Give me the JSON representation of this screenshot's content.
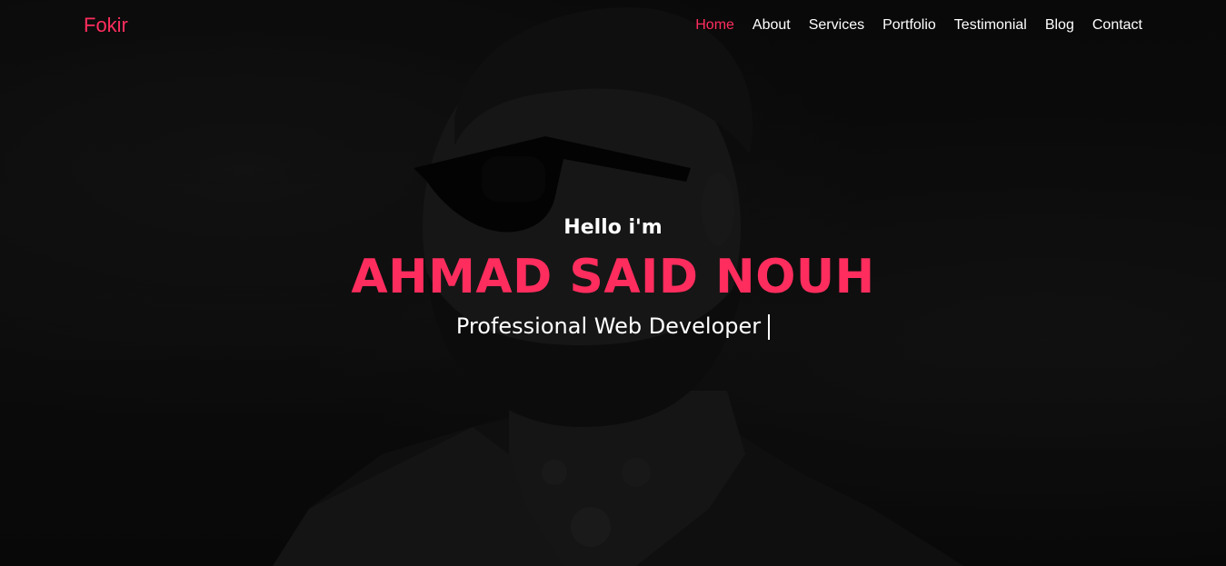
{
  "navbar": {
    "logo": "Fokir",
    "items": [
      {
        "label": "Home",
        "active": true
      },
      {
        "label": "About",
        "active": false
      },
      {
        "label": "Services",
        "active": false
      },
      {
        "label": "Portfolio",
        "active": false
      },
      {
        "label": "Testimonial",
        "active": false
      },
      {
        "label": "Blog",
        "active": false
      },
      {
        "label": "Contact",
        "active": false
      }
    ]
  },
  "hero": {
    "greeting": "Hello i'm",
    "name": "AHMAD SAID NOUH",
    "role": "Professional Web Developer"
  },
  "colors": {
    "accent": "#ff2d5e",
    "text": "#ffffff",
    "background": "#0b0b0b"
  }
}
